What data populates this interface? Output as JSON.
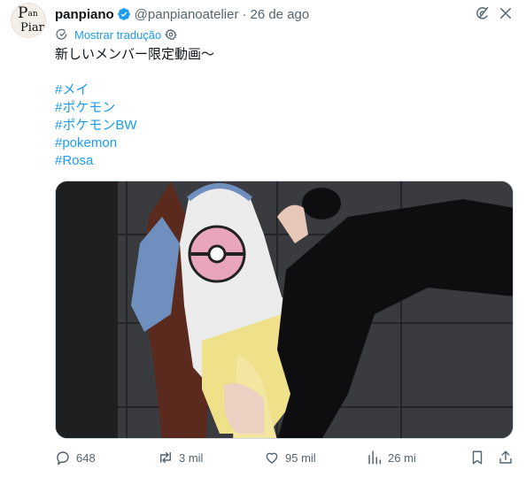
{
  "author": {
    "name": "panpiano",
    "handle": "@panpianoatelier",
    "separator": "·",
    "date": "26 de ago",
    "avatar_text_top": "Pan",
    "avatar_text_bottom": "Piano",
    "verified_color": "#1d9bf0"
  },
  "translate": {
    "label": "Mostrar tradução"
  },
  "post": {
    "text": "新しいメンバー限定動画〜",
    "hashtags": [
      "#メイ",
      "#ポケモン",
      "#ポケモンBW",
      "#pokemon",
      "#Rosa"
    ]
  },
  "media": {
    "icon": "video-thumbnail"
  },
  "metrics": {
    "replies": "648",
    "reposts": "3 mil",
    "likes": "95 mil",
    "views": "26 mi"
  },
  "colors": {
    "accent": "#1d9bf0",
    "muted": "#536471",
    "text": "#0f1419"
  }
}
